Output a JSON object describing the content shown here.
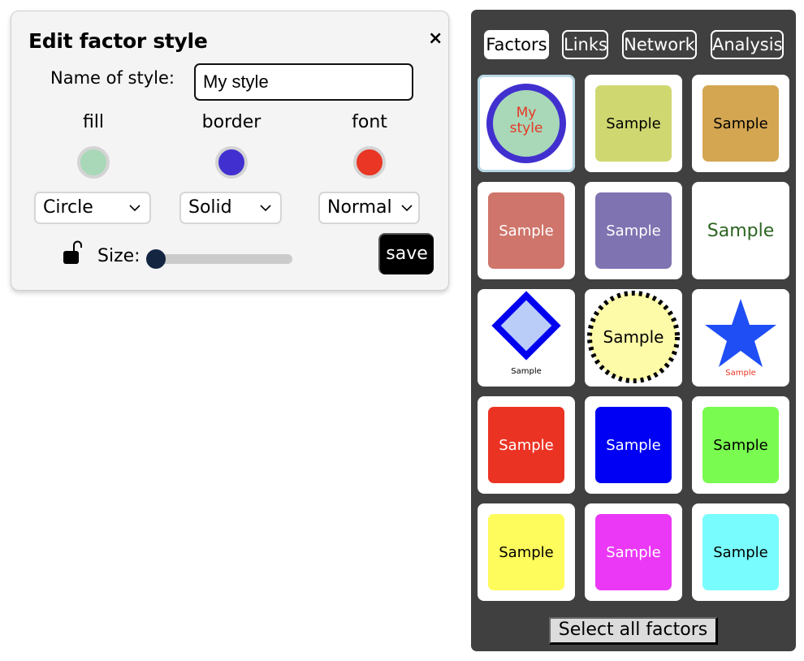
{
  "dialog": {
    "title": "Edit factor style",
    "close_icon": "×",
    "name_label": "Name of style:",
    "name_value": "My style",
    "columns": {
      "fill": {
        "label": "fill",
        "color": "#a8d8b8"
      },
      "border": {
        "label": "border",
        "color": "#4130cf"
      },
      "font": {
        "label": "font",
        "color": "#e93625"
      }
    },
    "selects": {
      "shape": "Circle",
      "border_style": "Solid",
      "font_style": "Normal"
    },
    "chevron": "⌵",
    "size_label": "Size:",
    "size_value": 0,
    "save_label": "save"
  },
  "panel": {
    "tabs": [
      {
        "label": "Factors",
        "active": true
      },
      {
        "label": "Links",
        "active": false
      },
      {
        "label": "Network",
        "active": false
      },
      {
        "label": "Analysis",
        "active": false
      }
    ],
    "tiles": [
      {
        "kind": "circle",
        "label": "My style",
        "fill": "#a8d8b8",
        "border": "#4130cf",
        "font": "#e93625",
        "selected": true
      },
      {
        "kind": "square",
        "label": "Sample",
        "fill": "#cfd870",
        "font": "#000000"
      },
      {
        "kind": "square",
        "label": "Sample",
        "fill": "#d4a652",
        "font": "#000000"
      },
      {
        "kind": "square",
        "label": "Sample",
        "fill": "#cf756b",
        "font": "#ffffff"
      },
      {
        "kind": "square",
        "label": "Sample",
        "fill": "#8073b1",
        "font": "#ffffff"
      },
      {
        "kind": "text",
        "label": "Sample",
        "fill": "#ffffff",
        "font": "#2d6422"
      },
      {
        "kind": "diamond",
        "label": "Sample",
        "fill": "#b9cdf8",
        "border": "#0000f0",
        "font": "#000000"
      },
      {
        "kind": "dashed-circle",
        "label": "Sample",
        "fill": "#fdfaa8",
        "border": "#000000",
        "font": "#000000"
      },
      {
        "kind": "star",
        "label": "Sample",
        "fill": "#1f4ef5",
        "font": "#e93625"
      },
      {
        "kind": "square",
        "label": "Sample",
        "fill": "#eb3324",
        "font": "#ffffff"
      },
      {
        "kind": "square",
        "label": "Sample",
        "fill": "#0000f5",
        "font": "#ffffff"
      },
      {
        "kind": "square",
        "label": "Sample",
        "fill": "#79fb4f",
        "font": "#000000"
      },
      {
        "kind": "square",
        "label": "Sample",
        "fill": "#fefb5c",
        "font": "#000000"
      },
      {
        "kind": "square",
        "label": "Sample",
        "fill": "#eb38f6",
        "font": "#ffffff"
      },
      {
        "kind": "square",
        "label": "Sample",
        "fill": "#79fcfd",
        "font": "#000000"
      }
    ],
    "select_all_label": "Select all factors"
  }
}
